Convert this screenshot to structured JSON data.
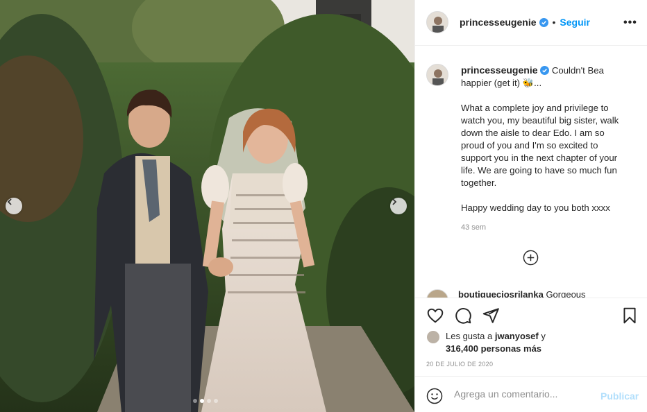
{
  "post": {
    "username": "princesseugenie",
    "follow_label": "Seguir",
    "separator": "•",
    "more_label": "•••",
    "caption_lines": [
      "Couldn't Bea happier (get it) 🐝...",
      "What a complete joy and privilege to watch you, my beautiful big sister, walk down the aisle to dear Edo. I am so proud of you and I'm so excited to support you in the next chapter of your life. We are going to have so much fun together.",
      "Happy wedding day to you both xxxx"
    ],
    "time_ago": "43 sem",
    "next_comment_user": "boutiqueciosrilanka",
    "next_comment_text": "Gorgeous"
  },
  "likes": {
    "prefix": "Les gusta a",
    "user": "jwanyosef",
    "conjunction": "y",
    "count": "316,400 personas más"
  },
  "date": "20 DE JULIO DE 2020",
  "comment": {
    "placeholder": "Agrega un comentario...",
    "publish_label": "Publicar"
  },
  "carousel": {
    "slides": 4,
    "active_index": 1
  },
  "icons": {
    "verified": "verified-badge-icon",
    "heart": "heart-icon",
    "comment": "comment-icon",
    "share": "share-icon",
    "save": "bookmark-icon",
    "emoji": "emoji-icon",
    "load_more": "plus-circle-icon",
    "prev": "chevron-left-icon",
    "next": "chevron-right-icon"
  },
  "colors": {
    "link": "#0095f6",
    "publish_disabled": "#b2dffc",
    "muted": "#8e8e8e",
    "text": "#262626"
  }
}
